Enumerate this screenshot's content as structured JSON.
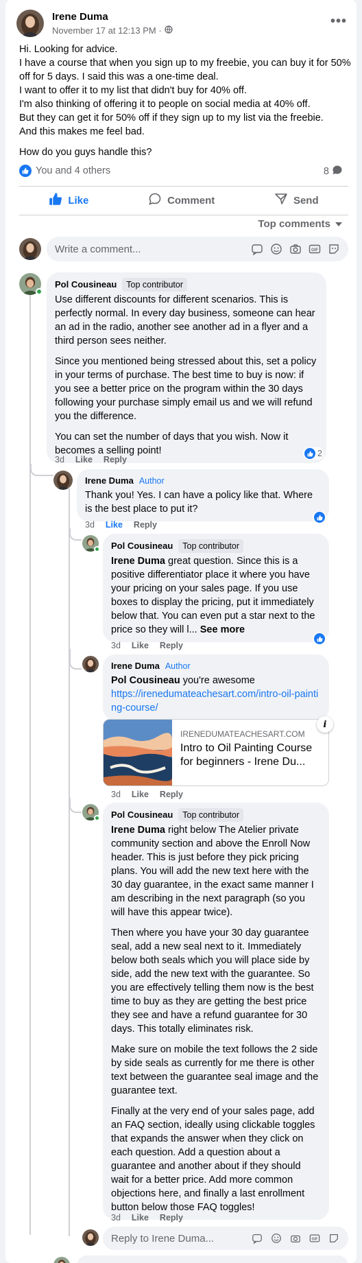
{
  "post": {
    "author": "Irene Duma",
    "timestamp": "November 17 at 12:13 PM ·",
    "paragraphs": [
      "Hi. Looking for advice.",
      "I have a course that when you sign up to my freebie, you can buy it for 50% off for 5 days. I said this was a one-time deal.",
      "I want to offer it to my list that didn't buy for 40% off.",
      "I'm also thinking of offering it to people on social media at 40% off.",
      "But they can get it for 50% off if they sign up to my list via the freebie.",
      "And this makes me feel bad."
    ],
    "question": "How do you guys handle this?",
    "reactions_text": "You and 4 others",
    "comment_count": "8"
  },
  "actions": {
    "like": "Like",
    "comment": "Comment",
    "send": "Send"
  },
  "sort_label": "Top comments",
  "write_placeholder": "Write a comment...",
  "reply_placeholder": "Reply to Irene Duma...",
  "labels": {
    "like": "Like",
    "reply": "Reply",
    "top_contributor": "Top contributor",
    "author": "Author",
    "see_more": "See more"
  },
  "comments": [
    {
      "name": "Pol Cousineau",
      "paragraphs": [
        "Use different discounts for different scenarios. This is perfectly normal. In every day business, someone can hear an ad in the radio, another see another ad in a flyer and a third person sees neither.",
        "Since you mentioned being stressed about this, set a policy in your terms of purchase. The best time to buy is now: if you see a better price on the program within the 30 days following your purchase simply email us and we will refund you the difference.",
        "You can set the number of days that you wish. Now it becomes a selling point!"
      ],
      "time": "3d",
      "reaction_count": "2"
    }
  ],
  "replies": [
    {
      "name": "Irene Duma",
      "text": "Thank you! Yes. I can have a policy like that. Where is the best place to put it?",
      "time": "3d"
    },
    {
      "name": "Pol Cousineau",
      "mention": "Irene Duma",
      "text": " great question. Since this is a positive differentiator place it where you have your pricing on your sales page. If you use boxes to display the pricing, put it immediately below that. You can even put a star next to the price so they will l...",
      "time": "3d"
    },
    {
      "name": "Irene Duma",
      "mention": "Pol Cousineau",
      "text": " you're awesome",
      "link": "https://irenedumateachesart.com/intro-oil-painting-course/",
      "preview_domain": "irenedumateachesart.com",
      "preview_title": "Intro to Oil Painting Course for beginners - Irene Du...",
      "time": "3d"
    },
    {
      "name": "Pol Cousineau",
      "mention": "Irene Duma",
      "first_text": " right below The Atelier private community section and above the Enroll Now header. This is just before they pick pricing plans. You will add the new text here with the 30 day guarantee, in the exact same manner I am describing in the next paragraph (so you will have this appear twice).",
      "paragraphs": [
        "Then where you have your 30 day guarantee seal, add a new seal next to it. Immediately below both seals which you will place side by side, add the new text with the guarantee. So you are effectively telling them now is the best time to buy as they are getting the best price they see and have a refund guarantee for 30 days. This totally eliminates risk.",
        "Make sure on mobile the text follows the 2 side by side seals as currently for me there is other text between the guarantee seal image and the guarantee text.",
        "Finally at the very end of your sales page, add an FAQ section, ideally using clickable toggles that expands the answer when they click on each question. Add a question about a guarantee and another about if they should wait for a better price. Add more common objections here, and finally a last enrollment button below those FAQ toggles!"
      ],
      "time": "3d"
    }
  ],
  "colors": {
    "accent": "#1877f2",
    "bubble": "#f0f2f5",
    "muted": "#65676b",
    "online": "#31a24c"
  },
  "icons": [
    "globe-icon",
    "more-icon",
    "like-icon",
    "comment-icon",
    "send-icon",
    "chevron-down-icon",
    "sticker-icon",
    "emoji-icon",
    "camera-icon",
    "gif-icon",
    "avatar-sticker-icon",
    "info-icon"
  ]
}
